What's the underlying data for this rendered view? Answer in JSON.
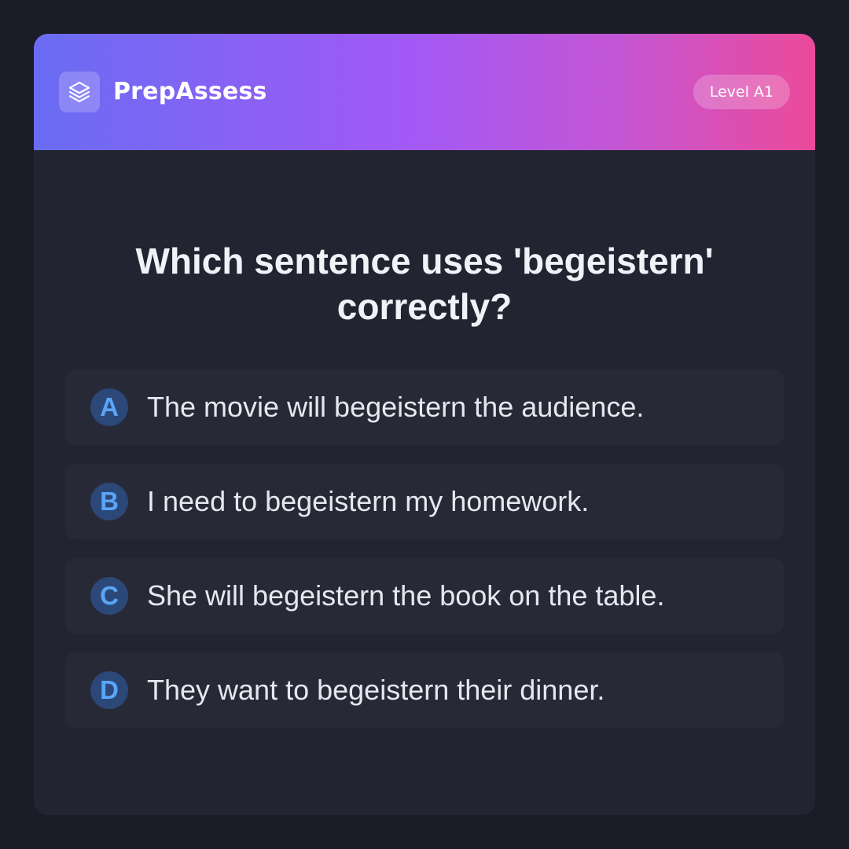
{
  "header": {
    "brand": "PrepAssess",
    "logo_icon": "stacked-layers-icon",
    "level": "Level A1"
  },
  "question": {
    "text": "Which sentence uses 'begeistern' correctly?"
  },
  "options": [
    {
      "letter": "A",
      "text": "The movie will begeistern the audience."
    },
    {
      "letter": "B",
      "text": "I need to begeistern my homework."
    },
    {
      "letter": "C",
      "text": "She will begeistern the book on the table."
    },
    {
      "letter": "D",
      "text": "They want to begeistern their dinner."
    }
  ],
  "colors": {
    "page_background": "#1b1c27",
    "card_background": "#222431",
    "gradient_start": "#6a6cf3",
    "gradient_mid": "#a259f5",
    "gradient_end": "#ec4a9a",
    "option_background": "#272937",
    "letter_accent": "#5aa5f6"
  }
}
